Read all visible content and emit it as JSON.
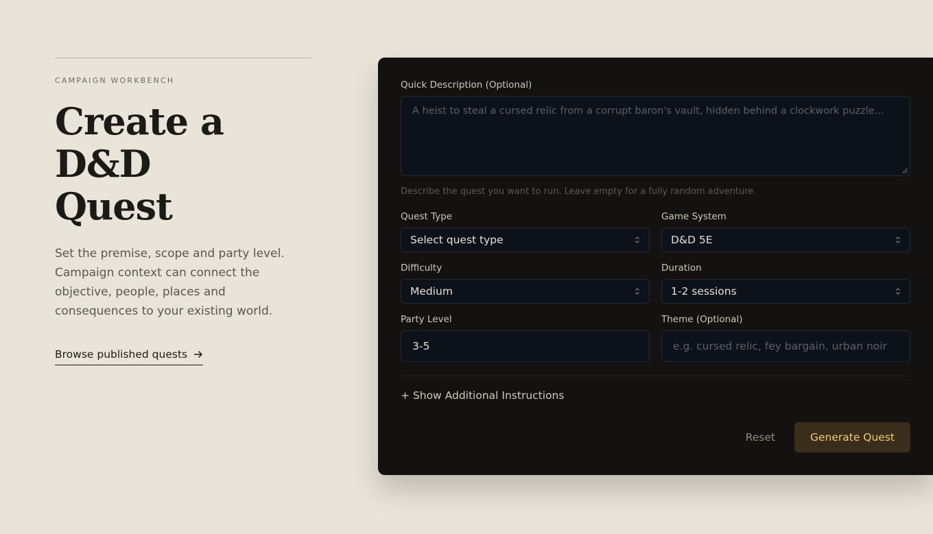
{
  "intro": {
    "eyebrow": "CAMPAIGN WORKBENCH",
    "title_line1": "Create a D&D",
    "title_line2": "Quest",
    "description": "Set the premise, scope and party level. Campaign context can connect the objective, people, places and consequences to your existing world.",
    "browse_label": "Browse published quests"
  },
  "form": {
    "description_label": "Quick Description (Optional)",
    "description_placeholder": "A heist to steal a cursed relic from a corrupt baron's vault, hidden behind a clockwork puzzle...",
    "description_help": "Describe the quest you want to run. Leave empty for a fully random adventure.",
    "quest_type": {
      "label": "Quest Type",
      "value": "Select quest type"
    },
    "game_system": {
      "label": "Game System",
      "value": "D&D 5E"
    },
    "difficulty": {
      "label": "Difficulty",
      "value": "Medium"
    },
    "duration": {
      "label": "Duration",
      "value": "1-2 sessions"
    },
    "party_level": {
      "label": "Party Level",
      "value": "3-5"
    },
    "theme": {
      "label": "Theme (Optional)",
      "placeholder": "e.g. cursed relic, fey bargain, urban noir"
    },
    "additional_instructions_label": "+ Show Additional Instructions",
    "reset_label": "Reset",
    "generate_label": "Generate Quest"
  },
  "colors": {
    "page_bg": "#e8e4da",
    "card_bg": "#141210",
    "field_bg": "#0d111a",
    "accent": "#efc97a",
    "generate_bg": "#3a2d1c"
  }
}
